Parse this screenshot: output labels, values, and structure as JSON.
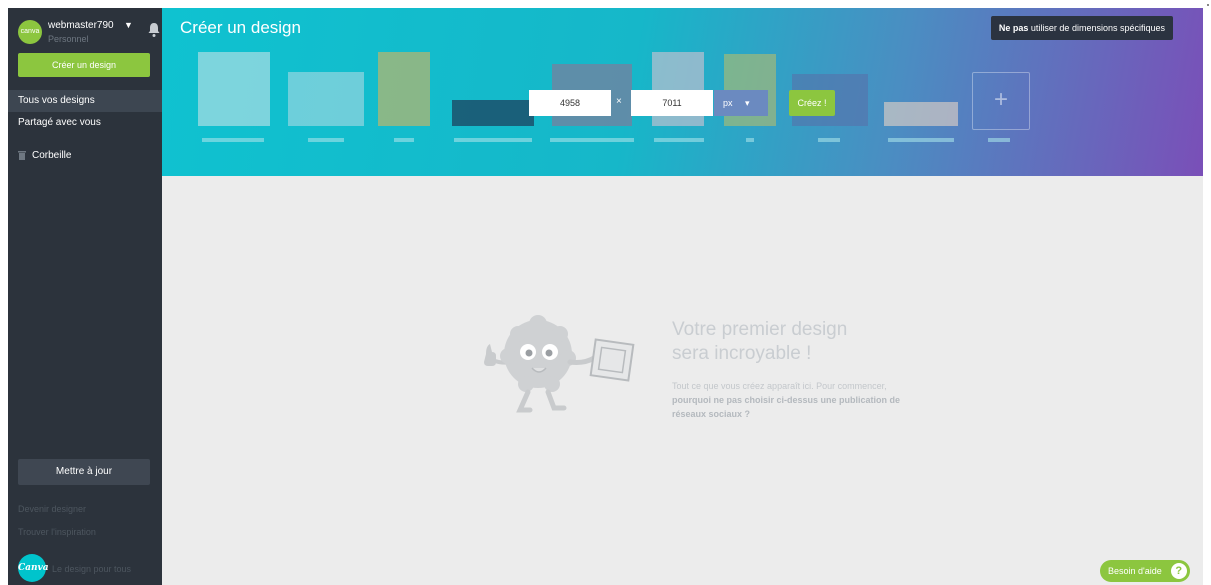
{
  "sidebar": {
    "user": {
      "name": "webmaster790",
      "plan": "Personnel",
      "avatar_text": "canva"
    },
    "create_button": "Créer un design",
    "nav": [
      {
        "label": "Tous vos designs",
        "active": true
      },
      {
        "label": "Partagé avec vous",
        "active": false
      }
    ],
    "trash_label": "Corbeille",
    "update_button": "Mettre à jour",
    "become_designer": "Devenir designer",
    "find_inspiration": "Trouver l'inspiration",
    "logo_text": "Canva",
    "tagline": "Le design pour tous"
  },
  "header": {
    "title": "Créer un design",
    "no_dimensions_bold": "Ne pas",
    "no_dimensions_rest": " utiliser de dimensions spécifiques",
    "width_value": "4958",
    "height_value": "7011",
    "separator": "×",
    "unit": "px",
    "unit_caret": "▾",
    "create_button": "Créez !",
    "plus_icon": "+"
  },
  "empty_state": {
    "title_line1": "Votre premier design",
    "title_line2": "sera incroyable !",
    "desc_plain": "Tout ce que vous créez apparaît ici. Pour commencer, ",
    "desc_bold": "pourquoi ne pas choisir ci-dessus une publication de réseaux sociaux ?"
  },
  "help_button": {
    "label": "Besoin d'aide",
    "icon_text": "?"
  },
  "colors": {
    "sidebar_bg": "#2c333c",
    "accent_green": "#8cc63f",
    "banner_start": "#0fc2d0",
    "banner_end": "#7a4fb8",
    "main_bg": "#ececec"
  }
}
